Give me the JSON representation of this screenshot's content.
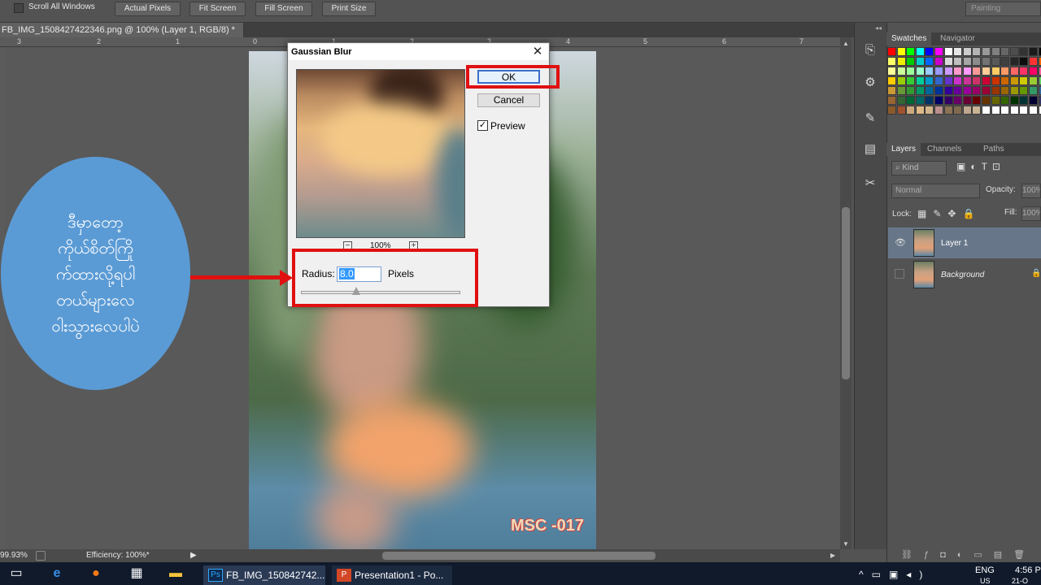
{
  "options_bar": {
    "scroll_all_windows": "Scroll All Windows",
    "buttons": [
      "Actual Pixels",
      "Fit Screen",
      "Fill Screen",
      "Print Size"
    ],
    "workspace": "Painting"
  },
  "document": {
    "tab_title": "FB_IMG_1508427422346.png @ 100% (Layer 1, RGB/8) *",
    "ruler_ticks": [
      "3",
      "2",
      "1",
      "0",
      "1",
      "2",
      "3",
      "4",
      "5",
      "6",
      "7"
    ]
  },
  "status": {
    "zoom": "99.93%",
    "efficiency": "Efficiency: 100%*"
  },
  "dialog": {
    "title": "Gaussian Blur",
    "close": "✕",
    "ok": "OK",
    "cancel": "Cancel",
    "preview_label": "Preview",
    "preview_checked": true,
    "zoom_level": "100%",
    "zoom_out": "−",
    "zoom_in": "+",
    "radius_label": "Radius:",
    "radius_value": "8.0",
    "radius_unit": "Pixels"
  },
  "annotation": {
    "bubble_lines": [
      "ဒီမှာတော့",
      "ကိုယ်စိတ်ကြို",
      "က်ထားလို့ရပါ",
      "တယ်များလေ",
      "ဝါးသွားလေပါပဲ"
    ],
    "watermark": "MSC -017",
    "colors": {
      "highlight": "#e01010",
      "bubble": "#5b9bd5"
    }
  },
  "panels": {
    "swatches_tabs": [
      "Swatches",
      "Navigator"
    ],
    "layers_tabs": [
      "Layers",
      "Channels",
      "Paths"
    ],
    "kind_filter": "Kind",
    "blend_mode": "Normal",
    "opacity_label": "Opacity:",
    "opacity_value": "100%",
    "lock_label": "Lock:",
    "fill_label": "Fill:",
    "fill_value": "100%",
    "layers": [
      {
        "name": "Layer 1",
        "visible": true,
        "selected": true
      },
      {
        "name": "Background",
        "visible": false,
        "selected": false
      }
    ]
  },
  "taskbar": {
    "apps": [
      "FB_IMG_150842742...",
      "Presentation1 - Po..."
    ],
    "language": "ENG",
    "language_sub": "US",
    "time": "4:56 P",
    "date": "21-O"
  },
  "swatch_colors": [
    [
      "#ff0000",
      "#ffff00",
      "#00ff00",
      "#00ffff",
      "#0000ff",
      "#ff00ff",
      "#ffffff",
      "#e6e6e6",
      "#cccccc",
      "#b3b3b3",
      "#999999",
      "#808080",
      "#666666",
      "#4d4d4d",
      "#333333",
      "#1a1a1a",
      "#000000"
    ],
    [
      "#ffff66",
      "#eeee00",
      "#00cc00",
      "#00cccc",
      "#0066ff",
      "#cc00cc",
      "#d9d9d9",
      "#bfbfbf",
      "#a6a6a6",
      "#8c8c8c",
      "#737373",
      "#595959",
      "#404040",
      "#262626",
      "#0d0d0d",
      "#ff3333",
      "#ff6600"
    ],
    [
      "#ffff99",
      "#ccff99",
      "#99ff99",
      "#99ffcc",
      "#99ccff",
      "#9999ff",
      "#cc99ff",
      "#ff99cc",
      "#ff99ff",
      "#ff9999",
      "#ffcc99",
      "#ffcc66",
      "#ff9966",
      "#ff6666",
      "#ff3366",
      "#ff0066",
      "#ff6699"
    ],
    [
      "#ffcc00",
      "#99cc00",
      "#33cc33",
      "#00cc99",
      "#0099cc",
      "#3366cc",
      "#6633cc",
      "#cc33cc",
      "#cc3399",
      "#cc3366",
      "#cc0033",
      "#cc3300",
      "#cc6600",
      "#cc9900",
      "#cccc00",
      "#99cc33",
      "#66cc66"
    ],
    [
      "#cc9933",
      "#669933",
      "#339933",
      "#009966",
      "#006699",
      "#003399",
      "#330099",
      "#660099",
      "#990099",
      "#990066",
      "#990033",
      "#993300",
      "#996600",
      "#999900",
      "#669900",
      "#339966",
      "#336699"
    ],
    [
      "#996633",
      "#336633",
      "#006633",
      "#006666",
      "#003366",
      "#000066",
      "#330066",
      "#660066",
      "#660033",
      "#660000",
      "#663300",
      "#666600",
      "#336600",
      "#003300",
      "#003333",
      "#000033",
      "#333366"
    ],
    [
      "#8b5a2b",
      "#a0522d",
      "#cdaa7d",
      "#deb887",
      "#d2b48c",
      "#bc8f8f",
      "#8b7355",
      "#7f6a4f",
      "#bfa88f",
      "#c8b393",
      "#ffffff",
      "#ffffff",
      "#ffffff",
      "#ffffff",
      "#ffffff",
      "#ffffff",
      "#ffffff"
    ]
  ]
}
